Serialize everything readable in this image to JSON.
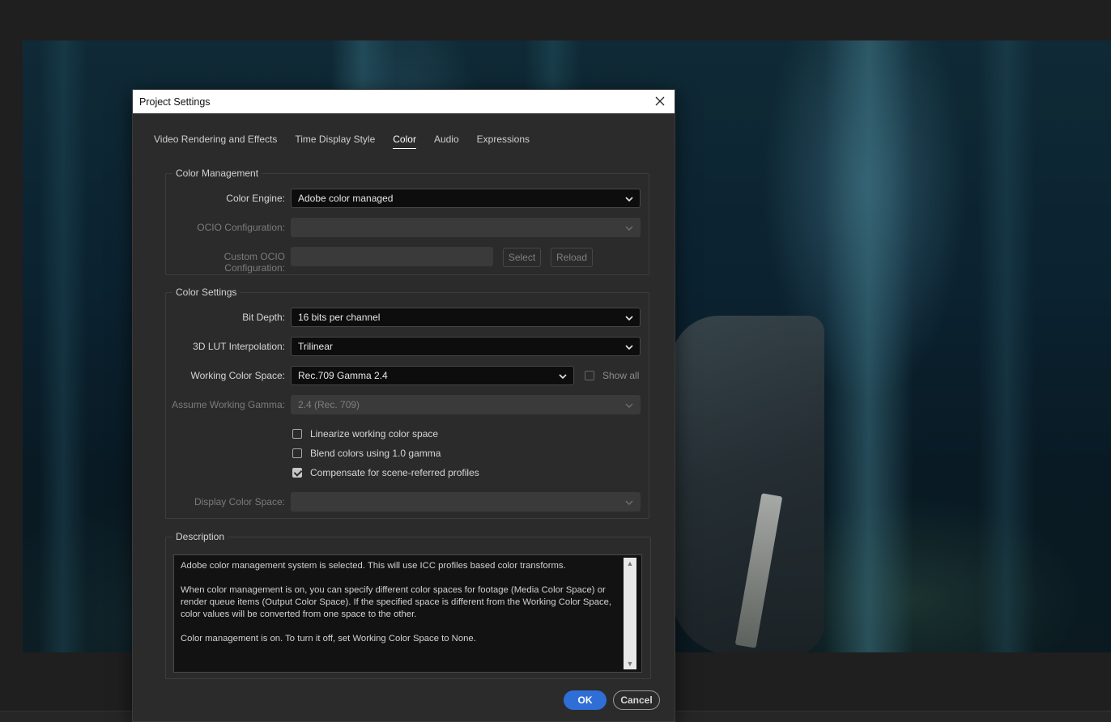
{
  "dialog": {
    "title": "Project Settings",
    "close_icon": "close-icon"
  },
  "tabs": [
    {
      "label": "Video Rendering and Effects",
      "active": false
    },
    {
      "label": "Time Display Style",
      "active": false
    },
    {
      "label": "Color",
      "active": true
    },
    {
      "label": "Audio",
      "active": false
    },
    {
      "label": "Expressions",
      "active": false
    }
  ],
  "color_management": {
    "legend": "Color Management",
    "color_engine": {
      "label": "Color Engine:",
      "value": "Adobe color managed"
    },
    "ocio_configuration": {
      "label": "OCIO Configuration:",
      "value": ""
    },
    "custom_ocio": {
      "label": "Custom OCIO Configuration:",
      "value": ""
    },
    "select_label": "Select",
    "reload_label": "Reload"
  },
  "color_settings": {
    "legend": "Color Settings",
    "bit_depth": {
      "label": "Bit Depth:",
      "value": "16 bits per channel"
    },
    "lut_interpolation": {
      "label": "3D LUT Interpolation:",
      "value": "Trilinear"
    },
    "working_color_space": {
      "label": "Working Color Space:",
      "value": "Rec.709 Gamma 2.4"
    },
    "show_all": {
      "label": "Show all",
      "checked": false
    },
    "assume_working_gamma": {
      "label": "Assume Working Gamma:",
      "value": "2.4 (Rec. 709)"
    },
    "linearize": {
      "label": "Linearize working color space",
      "checked": false
    },
    "blend_colors": {
      "label": "Blend colors using 1.0 gamma",
      "checked": false
    },
    "compensate": {
      "label": "Compensate for scene-referred profiles",
      "checked": true
    },
    "display_color_space": {
      "label": "Display Color Space:",
      "value": ""
    }
  },
  "description": {
    "legend": "Description",
    "paragraphs": [
      "Adobe color management system is selected. This will use ICC profiles based color transforms.",
      "When color management is on, you can specify different color spaces for footage (Media Color Space) or render queue items (Output Color Space). If the specified space is different from the Working Color Space, color values will be converted from one space to the other.",
      "Color management is on. To turn it off, set Working Color Space to None."
    ]
  },
  "buttons": {
    "ok": "OK",
    "cancel": "Cancel"
  },
  "colors": {
    "accent": "#2f6ed6",
    "dialog_bg": "#2b2b2b",
    "field_bg": "#0d0d0d"
  }
}
